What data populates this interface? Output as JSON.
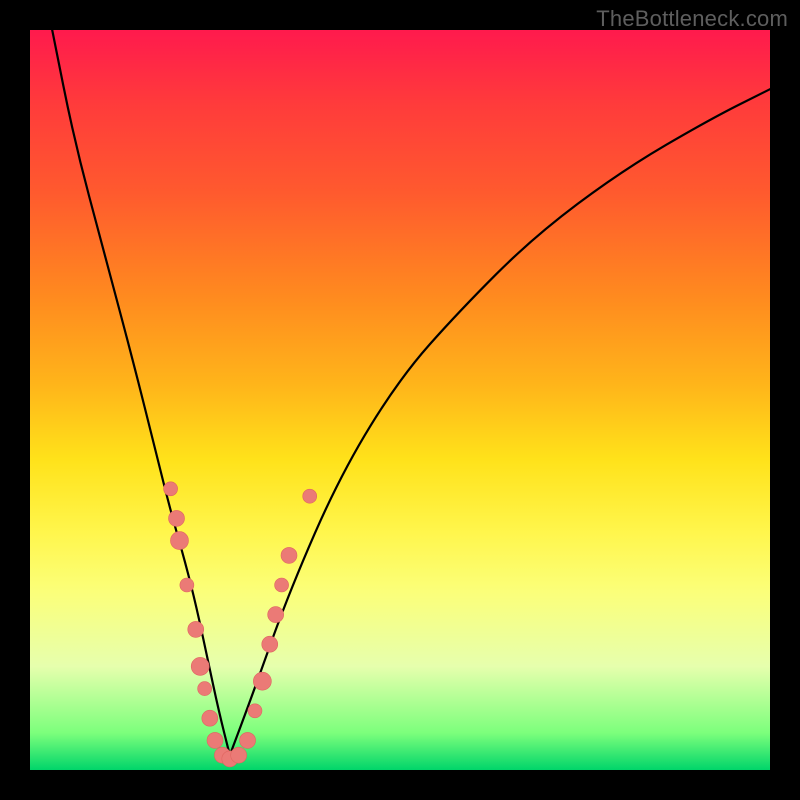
{
  "watermark": {
    "text": "TheBottleneck.com"
  },
  "chart_data": {
    "type": "line",
    "title": "",
    "xlabel": "",
    "ylabel": "",
    "xlim": [
      0,
      100
    ],
    "ylim": [
      0,
      100
    ],
    "grid": false,
    "legend": false,
    "series": [
      {
        "name": "left-branch",
        "x": [
          3,
          6,
          10,
          14,
          17,
          19,
          21,
          22.5,
          24,
          25.5,
          27
        ],
        "values": [
          100,
          85,
          70,
          55,
          43,
          35,
          28,
          22,
          15,
          8,
          2
        ]
      },
      {
        "name": "right-branch",
        "x": [
          27,
          30,
          35,
          42,
          50,
          58,
          68,
          80,
          92,
          100
        ],
        "values": [
          2,
          10,
          24,
          40,
          53,
          62,
          72,
          81,
          88,
          92
        ]
      }
    ],
    "markers": {
      "name": "highlighted-points",
      "points": [
        {
          "x": 19.0,
          "y": 38,
          "r": 7
        },
        {
          "x": 19.8,
          "y": 34,
          "r": 8
        },
        {
          "x": 20.2,
          "y": 31,
          "r": 9
        },
        {
          "x": 21.2,
          "y": 25,
          "r": 7
        },
        {
          "x": 22.4,
          "y": 19,
          "r": 8
        },
        {
          "x": 23.0,
          "y": 14,
          "r": 9
        },
        {
          "x": 23.6,
          "y": 11,
          "r": 7
        },
        {
          "x": 24.3,
          "y": 7,
          "r": 8
        },
        {
          "x": 25.0,
          "y": 4,
          "r": 8
        },
        {
          "x": 26.0,
          "y": 2,
          "r": 8
        },
        {
          "x": 27.0,
          "y": 1.5,
          "r": 8
        },
        {
          "x": 28.2,
          "y": 2,
          "r": 8
        },
        {
          "x": 29.4,
          "y": 4,
          "r": 8
        },
        {
          "x": 30.4,
          "y": 8,
          "r": 7
        },
        {
          "x": 31.4,
          "y": 12,
          "r": 9
        },
        {
          "x": 32.4,
          "y": 17,
          "r": 8
        },
        {
          "x": 33.2,
          "y": 21,
          "r": 8
        },
        {
          "x": 34.0,
          "y": 25,
          "r": 7
        },
        {
          "x": 35.0,
          "y": 29,
          "r": 8
        },
        {
          "x": 37.8,
          "y": 37,
          "r": 7
        }
      ]
    },
    "background": {
      "type": "vertical-gradient",
      "stops": [
        {
          "pos": 0,
          "color": "#ff1a4d"
        },
        {
          "pos": 50,
          "color": "#ffc61a"
        },
        {
          "pos": 80,
          "color": "#fbff7a"
        },
        {
          "pos": 100,
          "color": "#00D56A"
        }
      ]
    }
  }
}
